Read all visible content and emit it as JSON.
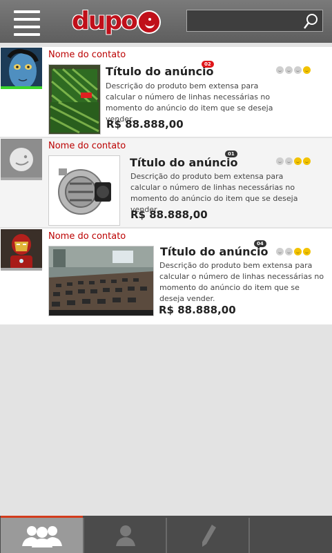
{
  "header": {
    "menu_icon": "hamburger-menu-icon",
    "logo_text": "dupo",
    "search_placeholder": "",
    "search_icon": "search-icon"
  },
  "listings": [
    {
      "contact": "Nome do contato",
      "avatar": "avatar-blue-alien",
      "status_color": "#3bd62c",
      "badge": "02",
      "badge_color": "#e0161a",
      "title": "Título do anúncio",
      "description": "Descrição do produto bem extensa para calcular o número de linhas necessárias no momento do anúncio do item que se deseja vender.",
      "price": "R$ 88.888,00",
      "rating": 1,
      "thumb": "watermelon-image"
    },
    {
      "contact": "Nome do contato",
      "avatar": "avatar-default-face",
      "status_color": "#a9a9a9",
      "badge": "01",
      "badge_color": "#333333",
      "title": "Título do anúncio",
      "description": "Descrição do produto bem extensa para calcular o número de linhas necessárias no momento do anúncio do item que se deseja vender.",
      "price": "R$ 88.888,00",
      "rating": 2,
      "thumb": "alternator-image"
    },
    {
      "contact": "Nome do contato",
      "avatar": "avatar-iron-man",
      "status_color": "#a9a9a9",
      "badge": "04",
      "badge_color": "#333333",
      "title": "Título do anúncio",
      "description": "Descrição do produto bem extensa para calcular o número de linhas necessárias no momento do anúncio do item que se deseja vender.",
      "price": "R$ 88.888,00",
      "rating": 2,
      "thumb": "phones-table-image"
    }
  ],
  "tabs": [
    {
      "icon": "contacts-group-icon",
      "active": true
    },
    {
      "icon": "user-profile-icon",
      "active": false
    },
    {
      "icon": "pencil-edit-icon",
      "active": false
    },
    {
      "icon": "empty-tab",
      "active": false
    }
  ],
  "colors": {
    "accent": "#d33b1c",
    "brand_red": "#c0101a"
  }
}
